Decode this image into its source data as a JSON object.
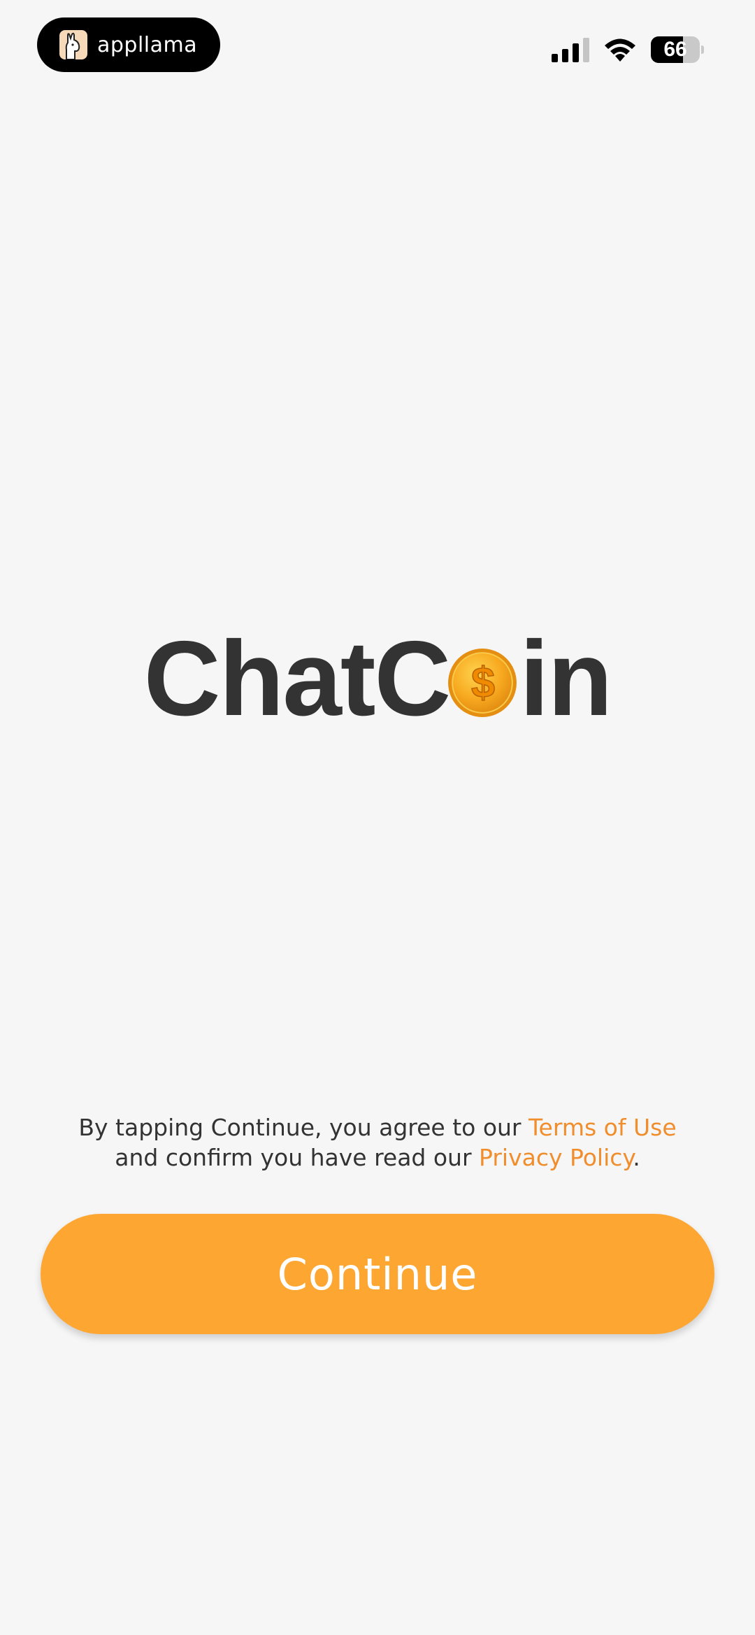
{
  "status_bar": {
    "brand_name": "appllama",
    "battery_level": 66,
    "battery_text": "66",
    "signal_bars_active": 3,
    "signal_bars_total": 4,
    "icons": [
      "llama-icon",
      "cellular-signal-icon",
      "wifi-icon",
      "battery-icon"
    ]
  },
  "logo": {
    "text_before_coin": "ChatC",
    "text_after_coin": "in",
    "coin_symbol": "$",
    "coin_icon": "gold-coin-icon"
  },
  "consent": {
    "line1_prefix": "By tapping Continue, you agree to our ",
    "terms_link": "Terms of Use",
    "line2_prefix": "and confirm you have read our ",
    "privacy_link": "Privacy Policy",
    "line2_suffix": "."
  },
  "continue_button": {
    "label": "Continue"
  },
  "colors": {
    "background": "#f6f6f6",
    "accent": "#fea632",
    "link": "#f08d2c",
    "logo_text": "#333333",
    "coin_gold": "#f5a81c"
  }
}
